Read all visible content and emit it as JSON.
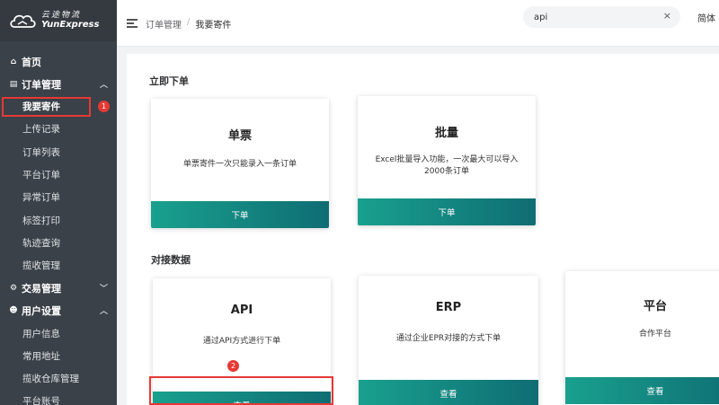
{
  "logo": {
    "cn": "云途物流",
    "en": "YunExpress"
  },
  "sidebar": {
    "home": "首页",
    "orders": {
      "label": "订单管理",
      "items": [
        "我要寄件",
        "上传记录",
        "订单列表",
        "平台订单",
        "异常订单",
        "标签打印",
        "轨迹查询",
        "揽收管理"
      ]
    },
    "trade": {
      "label": "交易管理"
    },
    "user": {
      "label": "用户设置",
      "items": [
        "用户信息",
        "常用地址",
        "揽收仓库管理",
        "平台账号"
      ]
    }
  },
  "badges": {
    "one": "1",
    "two": "2"
  },
  "header": {
    "breadcrumb": [
      "订单管理",
      "/",
      "我要寄件"
    ],
    "search_value": "api",
    "clear": "×",
    "lang": "简体"
  },
  "sections": {
    "place_order": {
      "title": "立即下单",
      "cards": [
        {
          "title": "单票",
          "desc": "单票寄件一次只能录入一条订单",
          "button": "下单"
        },
        {
          "title": "批量",
          "desc": "Excel批量导入功能，一次最大可以导入2000条订单",
          "button": "下单"
        }
      ]
    },
    "integration": {
      "title": "对接数据",
      "cards": [
        {
          "title": "API",
          "desc": "通过API方式进行下单",
          "button": "查看"
        },
        {
          "title": "ERP",
          "desc": "通过企业EPR对接的方式下单",
          "button": "查看"
        },
        {
          "title": "平台",
          "desc": "合作平台",
          "button": "查看"
        }
      ]
    }
  },
  "colors": {
    "sidebar": "#3a4148",
    "button_teal": "#149685",
    "highlight_red": "#e53935"
  }
}
